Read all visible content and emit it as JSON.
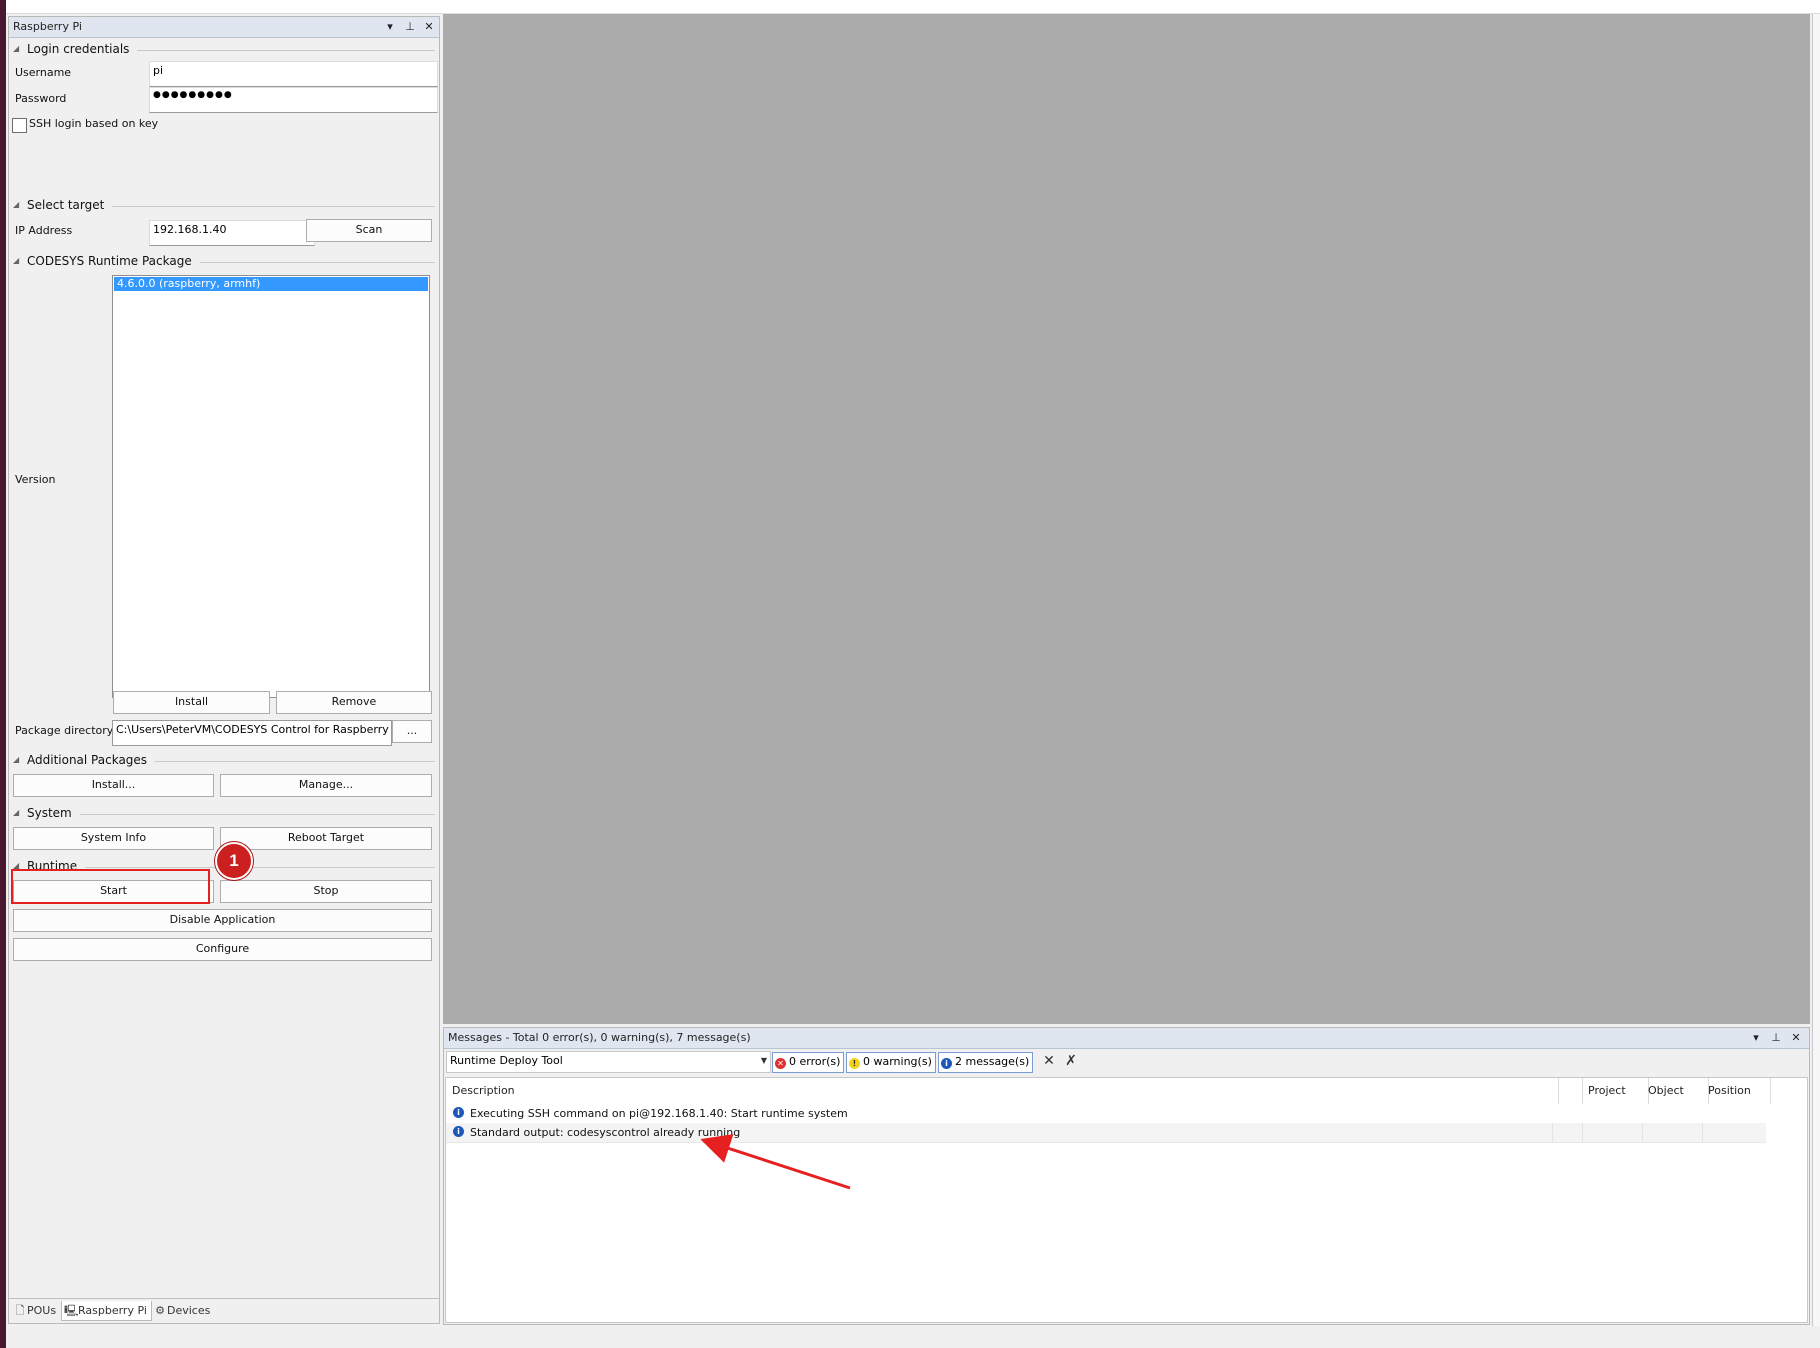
{
  "left_panel": {
    "title": "Raspberry Pi",
    "sections": {
      "login": "Login credentials",
      "select_target": "Select target",
      "runtime_package": "CODESYS Runtime Package",
      "additional_packages": "Additional Packages",
      "system": "System",
      "runtime": "Runtime"
    },
    "username_label": "Username",
    "username_value": "pi",
    "password_label": "Password",
    "password_value": "●●●●●●●●●",
    "ssh_key_label": "SSH login based on key",
    "ip_label": "IP Address",
    "ip_value": "192.168.1.40",
    "scan_button": "Scan",
    "version_label": "Version",
    "versions": [
      "4.6.0.0 (raspberry, armhf)"
    ],
    "install_button": "Install",
    "remove_button": "Remove",
    "package_dir_label": "Package directory",
    "package_dir_value": "C:\\Users\\PeterVM\\CODESYS Control for Raspberry PI",
    "browse_button": "...",
    "additional_install_button": "Install...",
    "manage_button": "Manage...",
    "system_info_button": "System Info",
    "reboot_button": "Reboot Target",
    "start_button": "Start",
    "stop_button": "Stop",
    "disable_app_button": "Disable Application",
    "configure_button": "Configure"
  },
  "bottom_tabs": [
    {
      "label": "POUs",
      "icon": "document-icon"
    },
    {
      "label": "Raspberry Pi",
      "icon": "computer-icon"
    },
    {
      "label": "Devices",
      "icon": "devices-icon"
    }
  ],
  "messages": {
    "title": "Messages - Total 0 error(s), 0 warning(s), 7 message(s)",
    "source": "Runtime Deploy Tool",
    "errors_filter": "0 error(s)",
    "warnings_filter": "0 warning(s)",
    "messages_filter": "2 message(s)",
    "columns": {
      "description": "Description",
      "project": "Project",
      "object": "Object",
      "position": "Position"
    },
    "rows": [
      "Executing SSH command on pi@192.168.1.40: Start runtime system",
      "Standard output: codesyscontrol already running"
    ]
  },
  "annotation": {
    "badge": "1",
    "color": "#e62020"
  },
  "colors": {
    "workspace": "#ababab",
    "selection": "#3399ff",
    "title_bar": "#dfe6ef"
  }
}
